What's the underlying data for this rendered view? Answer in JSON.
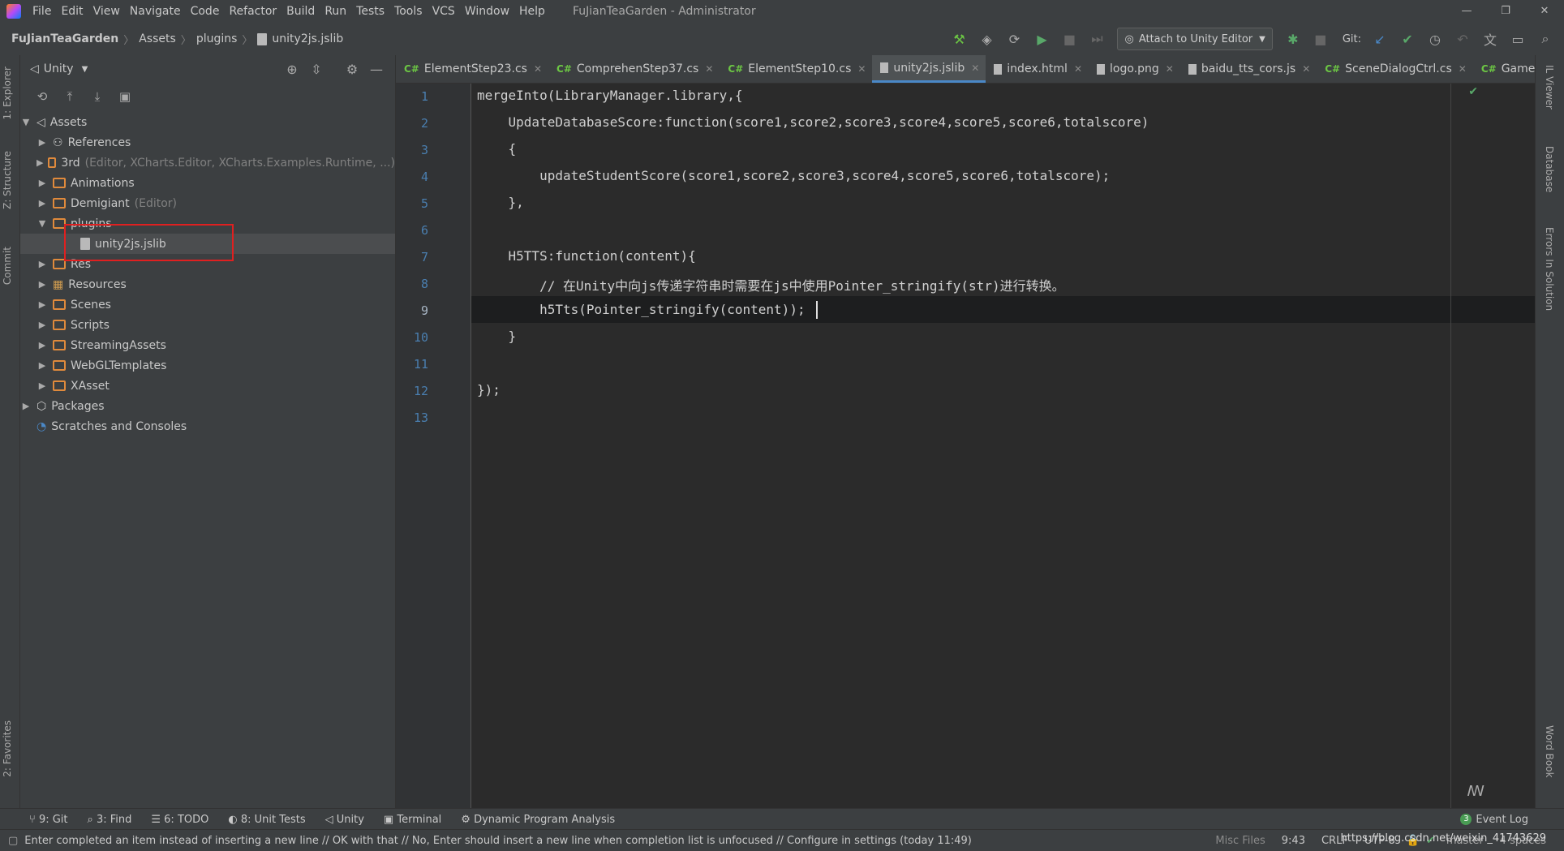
{
  "menu": {
    "items": [
      "File",
      "Edit",
      "View",
      "Navigate",
      "Code",
      "Refactor",
      "Build",
      "Run",
      "Tests",
      "Tools",
      "VCS",
      "Window",
      "Help"
    ],
    "window_title": "FuJianTeaGarden - Administrator"
  },
  "navbar": {
    "breadcrumbs": [
      "FuJianTeaGarden",
      "Assets",
      "plugins",
      "unity2js.jslib"
    ],
    "attach_label": "Attach to Unity Editor",
    "git_label": "Git:"
  },
  "left_stripe": {
    "explorer": "1: Explorer",
    "structure": "Z: Structure",
    "commit": "Commit",
    "favorites": "2: Favorites"
  },
  "project": {
    "view_label": "Unity",
    "tree": [
      {
        "label": "Assets",
        "hint": ""
      },
      {
        "label": "References",
        "hint": ""
      },
      {
        "label": "3rd",
        "hint": "(Editor, XCharts.Editor, XCharts.Examples.Runtime, ...)"
      },
      {
        "label": "Animations",
        "hint": ""
      },
      {
        "label": "Demigiant",
        "hint": "(Editor)"
      },
      {
        "label": "plugins",
        "hint": ""
      },
      {
        "label": "unity2js.jslib",
        "hint": ""
      },
      {
        "label": "Res",
        "hint": ""
      },
      {
        "label": "Resources",
        "hint": ""
      },
      {
        "label": "Scenes",
        "hint": ""
      },
      {
        "label": "Scripts",
        "hint": ""
      },
      {
        "label": "StreamingAssets",
        "hint": ""
      },
      {
        "label": "WebGLTemplates",
        "hint": ""
      },
      {
        "label": "XAsset",
        "hint": ""
      },
      {
        "label": "Packages",
        "hint": ""
      },
      {
        "label": "Scratches and Consoles",
        "hint": ""
      }
    ]
  },
  "tabs": [
    {
      "label": "ElementStep23.cs",
      "prefix": "C#"
    },
    {
      "label": "ComprehenStep37.cs",
      "prefix": "C#"
    },
    {
      "label": "ElementStep10.cs",
      "prefix": "C#"
    },
    {
      "label": "unity2js.jslib",
      "prefix": ""
    },
    {
      "label": "index.html",
      "prefix": ""
    },
    {
      "label": "logo.png",
      "prefix": ""
    },
    {
      "label": "baidu_tts_cors.js",
      "prefix": ""
    },
    {
      "label": "SceneDialogCtrl.cs",
      "prefix": "C#"
    },
    {
      "label": "GameCtrl.",
      "prefix": "C#"
    }
  ],
  "editor": {
    "line_numbers": [
      "1",
      "2",
      "3",
      "4",
      "5",
      "6",
      "7",
      "8",
      "9",
      "10",
      "11",
      "12",
      "13"
    ],
    "lines": [
      "mergeInto(LibraryManager.library,{",
      "    UpdateDatabaseScore:function(score1,score2,score3,score4,score5,score6,totalscore)",
      "    {",
      "        updateStudentScore(score1,score2,score3,score4,score5,score6,totalscore);",
      "    },",
      "",
      "    H5TTS:function(content){",
      "        // 在Unity中向js传递字符串时需要在js中使用Pointer_stringify(str)进行转换。",
      "        h5Tts(Pointer_stringify(content));",
      "    }",
      "",
      "});",
      ""
    ]
  },
  "right_stripe": {
    "viewer": "IL Viewer",
    "database": "Database",
    "errors": "Errors In Solution",
    "wordbook": "Word Book"
  },
  "bottom_tools": [
    "9: Git",
    "3: Find",
    "6: TODO",
    "8: Unit Tests",
    "Unity",
    "Terminal",
    "Dynamic Program Analysis"
  ],
  "event_log": {
    "count": "3",
    "label": "Event Log"
  },
  "status": {
    "message": "Enter completed an item instead of inserting a new line // OK with that // No, Enter should insert a new line when completion list is unfocused // Configure in settings (today 11:49)",
    "misc": "Misc Files",
    "position": "9:43",
    "line_sep": "CRLF",
    "encoding": "UTF-8",
    "branch": "master",
    "indent": "4 spaces",
    "watermark": "https://blog.csdn.net/weixin_41743629"
  }
}
